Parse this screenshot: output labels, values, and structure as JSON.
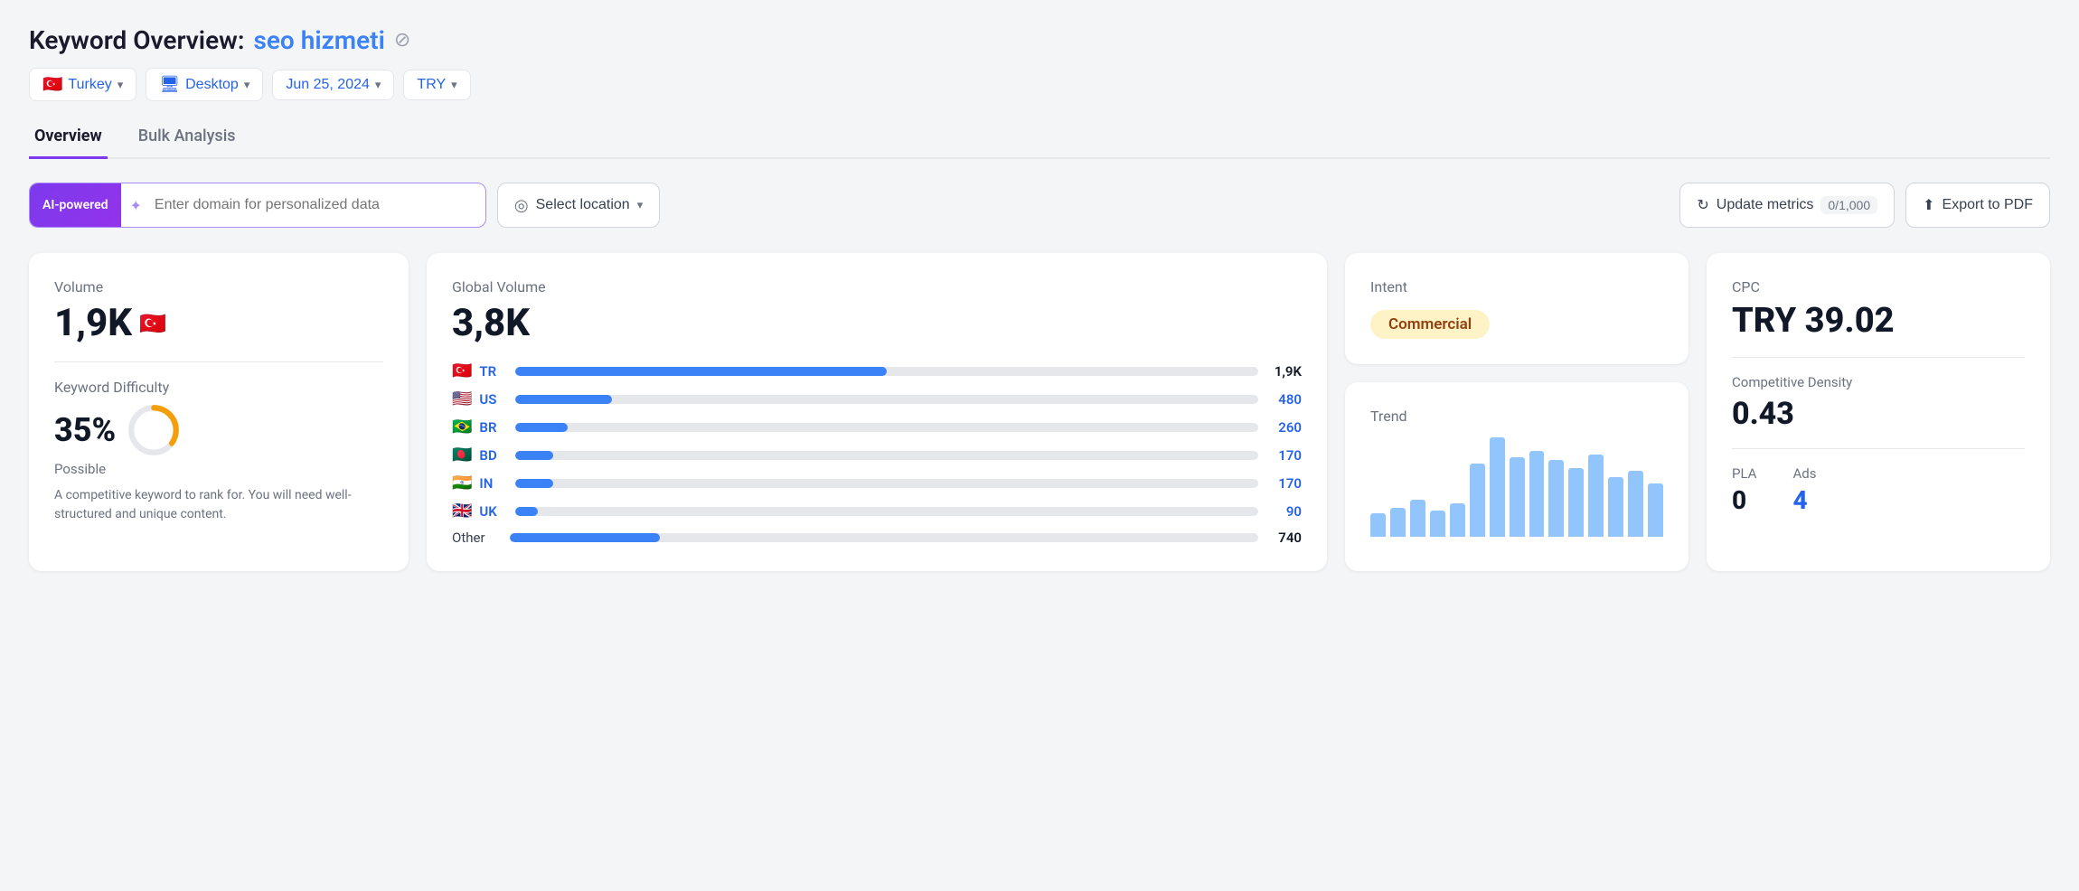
{
  "header": {
    "title_static": "Keyword Overview:",
    "keyword": "seo hizmeti",
    "verified_icon": "✓"
  },
  "filters": [
    {
      "id": "country",
      "flag": "🇹🇷",
      "label": "Turkey",
      "has_chevron": true
    },
    {
      "id": "device",
      "icon": "🖥",
      "label": "Desktop",
      "has_chevron": true
    },
    {
      "id": "date",
      "label": "Jun 25, 2024",
      "has_chevron": true
    },
    {
      "id": "currency",
      "label": "TRY",
      "has_chevron": true
    }
  ],
  "tabs": [
    {
      "id": "overview",
      "label": "Overview",
      "active": true
    },
    {
      "id": "bulk-analysis",
      "label": "Bulk Analysis",
      "active": false
    }
  ],
  "toolbar": {
    "ai_badge": "AI-powered",
    "domain_placeholder": "Enter domain for personalized data",
    "location_placeholder": "Select location",
    "update_metrics_label": "Update metrics",
    "metrics_count": "0/1,000",
    "export_label": "Export to PDF"
  },
  "volume_card": {
    "label": "Volume",
    "value": "1,9K",
    "flag": "🇹🇷",
    "kd_label": "Keyword Difficulty",
    "kd_value": "35%",
    "kd_possible": "Possible",
    "kd_desc": "A competitive keyword to rank for. You will need well-structured and unique content.",
    "donut": {
      "filled": 35,
      "total": 100,
      "color_filled": "#f59e0b",
      "color_empty": "#e5e7eb"
    }
  },
  "global_volume_card": {
    "label": "Global Volume",
    "value": "3,8K",
    "countries": [
      {
        "flag": "🇹🇷",
        "code": "TR",
        "value": "1,9K",
        "bar_pct": 50,
        "value_color": "dark"
      },
      {
        "flag": "🇺🇸",
        "code": "US",
        "value": "480",
        "bar_pct": 13,
        "value_color": "blue"
      },
      {
        "flag": "🇧🇷",
        "code": "BR",
        "value": "260",
        "bar_pct": 7,
        "value_color": "blue"
      },
      {
        "flag": "🇧🇩",
        "code": "BD",
        "value": "170",
        "bar_pct": 5,
        "value_color": "blue"
      },
      {
        "flag": "🇮🇳",
        "code": "IN",
        "value": "170",
        "bar_pct": 5,
        "value_color": "blue"
      },
      {
        "flag": "🇬🇧",
        "code": "UK",
        "value": "90",
        "bar_pct": 3,
        "value_color": "blue"
      }
    ],
    "other_label": "Other",
    "other_value": "740",
    "other_bar_pct": 20
  },
  "intent_card": {
    "label": "Intent",
    "badge": "Commercial"
  },
  "trend_card": {
    "label": "Trend",
    "bars": [
      18,
      22,
      28,
      20,
      25,
      55,
      75,
      60,
      65,
      58,
      52,
      62,
      45,
      50,
      40
    ]
  },
  "cpc_card": {
    "cpc_label": "CPC",
    "cpc_value": "TRY 39.02",
    "comp_density_label": "Competitive Density",
    "comp_density_value": "0.43",
    "pla_label": "PLA",
    "pla_value": "0",
    "ads_label": "Ads",
    "ads_value": "4"
  }
}
